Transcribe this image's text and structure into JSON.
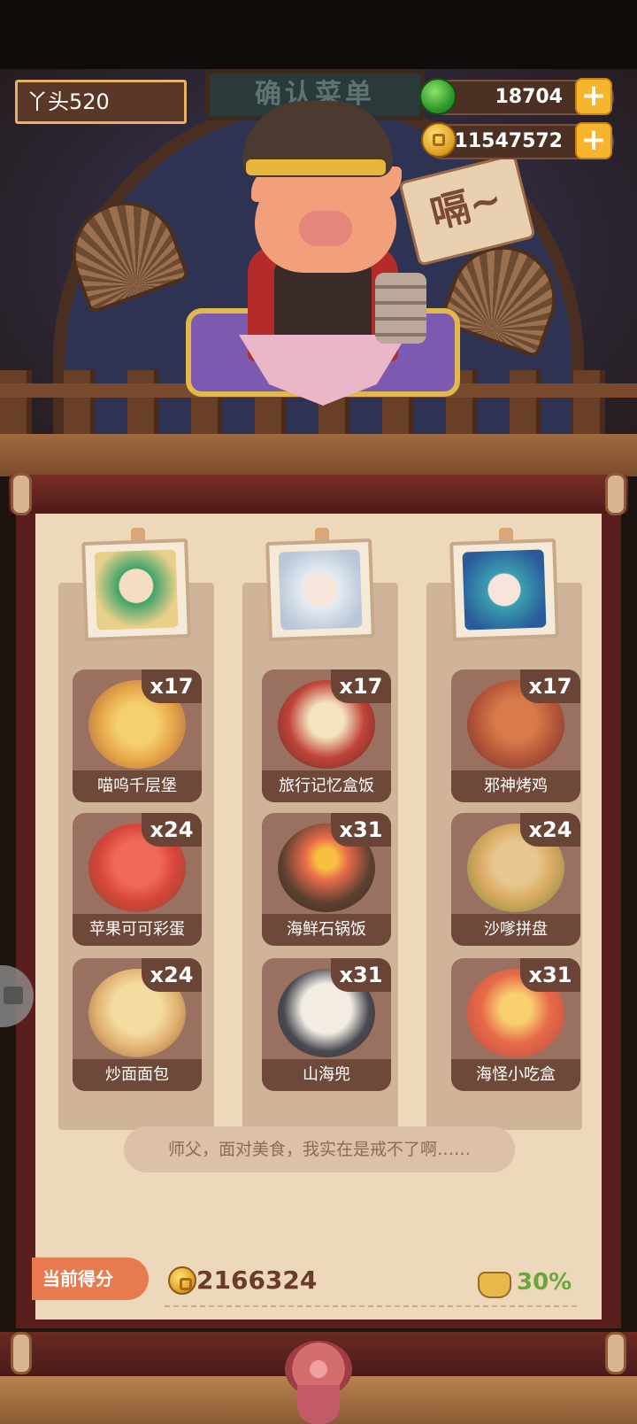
{
  "header": {
    "player_name": "丫头520",
    "plaque_text": "确认菜单",
    "emote_text": "嗝~"
  },
  "currency": {
    "gems": "18704",
    "coins": "11547572",
    "plus_label": "+"
  },
  "columns": [
    {
      "dishes": [
        {
          "name": "喵呜千层堡",
          "qty": "x17",
          "color": "#e8a84a"
        },
        {
          "name": "苹果可可彩蛋",
          "qty": "x24",
          "color": "#d8463a"
        },
        {
          "name": "炒面面包",
          "qty": "x24",
          "color": "#e0b070"
        }
      ]
    },
    {
      "dishes": [
        {
          "name": "旅行记忆盒饭",
          "qty": "x17",
          "color": "#c0443a"
        },
        {
          "name": "海鲜石锅饭",
          "qty": "x31",
          "color": "#5a4030"
        },
        {
          "name": "山海兜",
          "qty": "x31",
          "color": "#4a4a52"
        }
      ]
    },
    {
      "dishes": [
        {
          "name": "邪神烤鸡",
          "qty": "x17",
          "color": "#b85a3a"
        },
        {
          "name": "沙嗲拼盘",
          "qty": "x24",
          "color": "#d8a860"
        },
        {
          "name": "海怪小吃盒",
          "qty": "x31",
          "color": "#e86a4a"
        }
      ]
    }
  ],
  "speech": "师父，面对美食，我实在是戒不了啊……",
  "score": {
    "label": "当前得分",
    "value": "2166324",
    "percent": "30%"
  },
  "colors": {
    "accent_gold": "#f6b52c",
    "panel_dark": "#5a1e1c",
    "paper": "#eed8bc",
    "percent_green": "#6aa63a"
  }
}
